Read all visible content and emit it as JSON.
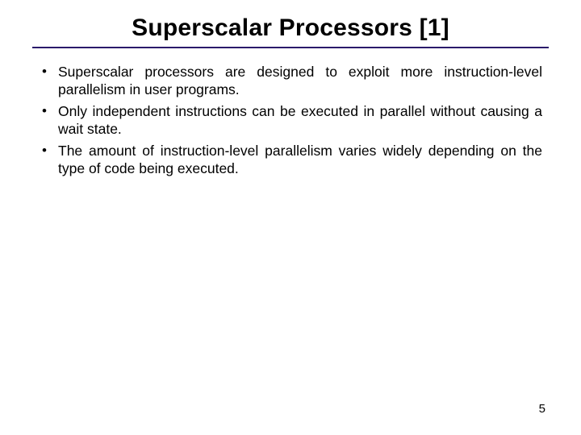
{
  "title": "Superscalar Processors [1]",
  "bullets": [
    "Superscalar processors are designed to exploit more instruction-level parallelism in user programs.",
    "Only independent instructions can be executed in parallel without causing a wait state.",
    "The amount of instruction-level parallelism varies widely depending on the type of code being executed."
  ],
  "page_number": "5"
}
